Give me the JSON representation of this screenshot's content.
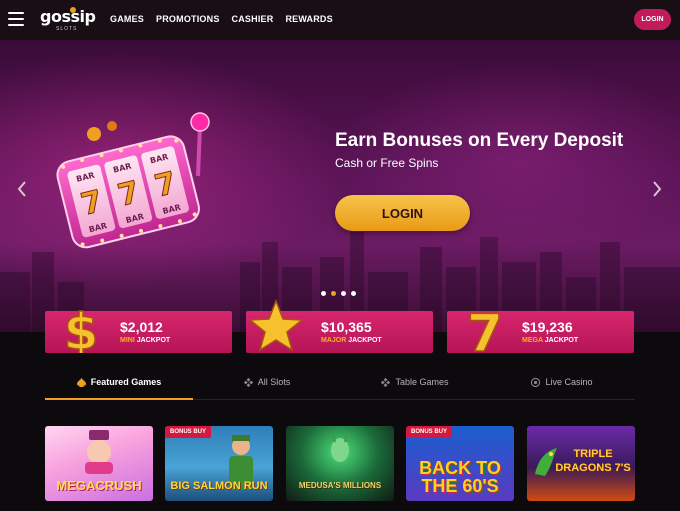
{
  "header": {
    "logo_text": "gossip",
    "logo_sub": "SLOTS",
    "nav": [
      "GAMES",
      "PROMOTIONS",
      "CASHIER",
      "REWARDS"
    ],
    "login_label": "LOGIN"
  },
  "hero": {
    "title": "Earn Bonuses on Every Deposit",
    "subtitle": "Cash or Free Spins",
    "login_label": "LOGIN",
    "slides_count": 4,
    "active_slide": 2,
    "reel_symbols": [
      "BAR",
      "7",
      "BAR",
      "BAR",
      "7",
      "BAR",
      "BAR",
      "7",
      "BAR"
    ]
  },
  "jackpots": [
    {
      "amount": "$2,012",
      "tier": "MINI",
      "word": "JACKPOT",
      "icon": "dollar-icon"
    },
    {
      "amount": "$10,365",
      "tier": "MAJOR",
      "word": "JACKPOT",
      "icon": "star-icon"
    },
    {
      "amount": "$19,236",
      "tier": "MEGA",
      "word": "JACKPOT",
      "icon": "seven-icon"
    }
  ],
  "tabs": [
    {
      "label": "Featured Games",
      "icon": "spade-icon",
      "active": true
    },
    {
      "label": "All Slots",
      "icon": "diamond-cluster-icon",
      "active": false
    },
    {
      "label": "Table Games",
      "icon": "diamond-cluster-icon",
      "active": false
    },
    {
      "label": "Live Casino",
      "icon": "chip-icon",
      "active": false
    }
  ],
  "games": [
    {
      "title": "MEGACRUSH",
      "badge": ""
    },
    {
      "title": "BIG SALMON RUN",
      "badge": "BONUS BUY"
    },
    {
      "title": "MEDUSA'S MILLIONS",
      "badge": ""
    },
    {
      "title": "BACK TO THE 60'S",
      "badge": "BONUS BUY"
    },
    {
      "title": "TRIPLE DRAGONS 7'S",
      "badge": ""
    }
  ],
  "colors": {
    "accent_gold": "#f0a020",
    "jackpot_pink": "#c8195f",
    "badge_red": "#d3193f"
  }
}
